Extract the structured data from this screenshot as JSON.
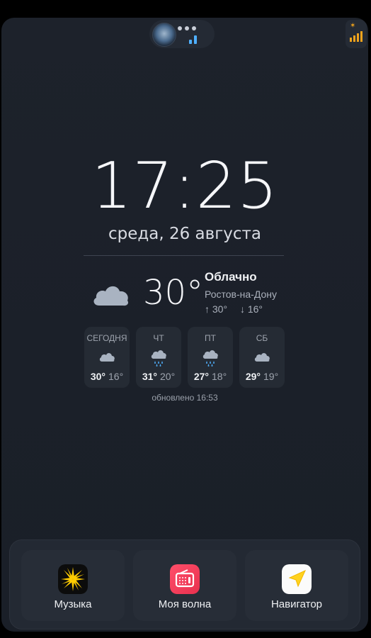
{
  "status": {
    "notification_dots": 3,
    "avatar_icon": "avatar-icon",
    "signal_icon": "signal-icon"
  },
  "clock": {
    "time": "17:25",
    "date": "среда, 26 августа"
  },
  "weather": {
    "icon": "cloud-icon",
    "temperature": "30°",
    "condition": "Облачно",
    "city": "Ростов-на-Дону",
    "high": "↑ 30°",
    "low": "↓ 16°",
    "updated": "обновлено 16:53",
    "forecast": [
      {
        "day": "СЕГОДНЯ",
        "icon": "cloud-icon",
        "hi": "30°",
        "lo": "16°"
      },
      {
        "day": "ЧТ",
        "icon": "rain-icon",
        "hi": "31°",
        "lo": "20°"
      },
      {
        "day": "ПТ",
        "icon": "rain-icon",
        "hi": "27°",
        "lo": "18°"
      },
      {
        "day": "СБ",
        "icon": "cloud-icon",
        "hi": "29°",
        "lo": "19°"
      }
    ]
  },
  "dock": {
    "apps": [
      {
        "label": "Музыка",
        "icon": "music-icon"
      },
      {
        "label": "Моя волна",
        "icon": "radio-icon"
      },
      {
        "label": "Навигатор",
        "icon": "navigator-icon"
      }
    ]
  },
  "colors": {
    "background": "#1b2029",
    "accent_blue": "#4fb0ff",
    "signal_orange": "#f0a31c",
    "radio_red": "#f2435a",
    "navigator_yellow": "#ffd21e"
  }
}
